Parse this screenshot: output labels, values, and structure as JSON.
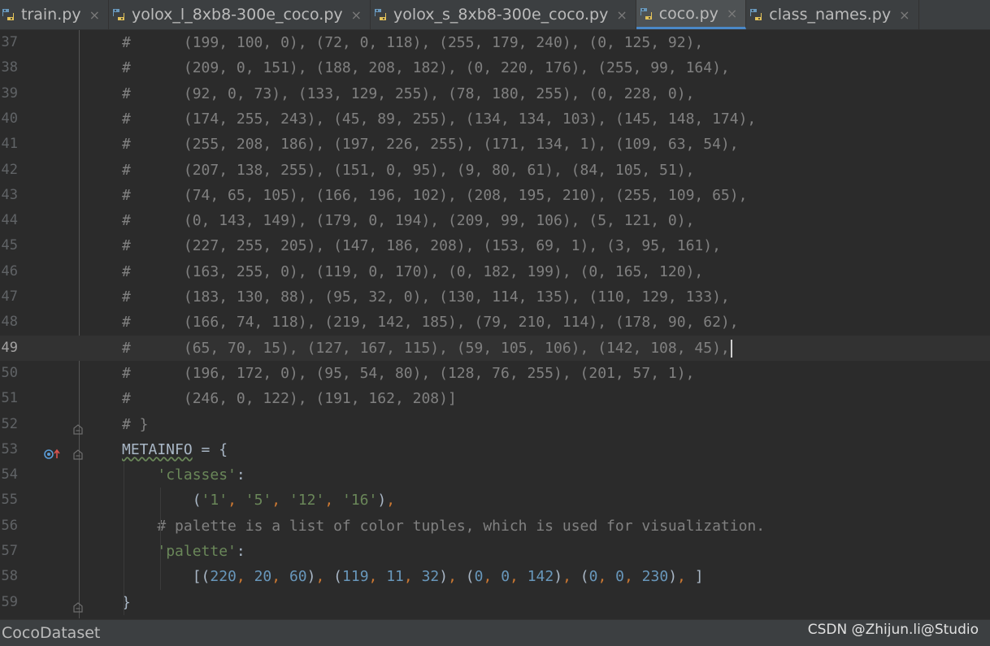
{
  "tabs": [
    {
      "label": "train.py",
      "icon": "python-file-icon",
      "active": false
    },
    {
      "label": "yolox_l_8xb8-300e_coco.py",
      "icon": "python-file-icon",
      "active": false
    },
    {
      "label": "yolox_s_8xb8-300e_coco.py",
      "icon": "python-file-icon",
      "active": false
    },
    {
      "label": "coco.py",
      "icon": "python-file-icon",
      "active": true
    },
    {
      "label": "class_names.py",
      "icon": "python-file-icon",
      "active": false
    }
  ],
  "close_glyph": "×",
  "lines": [
    {
      "n": "37",
      "text": "#      (199, 100, 0), (72, 0, 118), (255, 179, 240), (0, 125, 92),"
    },
    {
      "n": "38",
      "text": "#      (209, 0, 151), (188, 208, 182), (0, 220, 176), (255, 99, 164),"
    },
    {
      "n": "39",
      "text": "#      (92, 0, 73), (133, 129, 255), (78, 180, 255), (0, 228, 0),"
    },
    {
      "n": "40",
      "text": "#      (174, 255, 243), (45, 89, 255), (134, 134, 103), (145, 148, 174),"
    },
    {
      "n": "41",
      "text": "#      (255, 208, 186), (197, 226, 255), (171, 134, 1), (109, 63, 54),"
    },
    {
      "n": "42",
      "text": "#      (207, 138, 255), (151, 0, 95), (9, 80, 61), (84, 105, 51),"
    },
    {
      "n": "43",
      "text": "#      (74, 65, 105), (166, 196, 102), (208, 195, 210), (255, 109, 65),"
    },
    {
      "n": "44",
      "text": "#      (0, 143, 149), (179, 0, 194), (209, 99, 106), (5, 121, 0),"
    },
    {
      "n": "45",
      "text": "#      (227, 255, 205), (147, 186, 208), (153, 69, 1), (3, 95, 161),"
    },
    {
      "n": "46",
      "text": "#      (163, 255, 0), (119, 0, 170), (0, 182, 199), (0, 165, 120),"
    },
    {
      "n": "47",
      "text": "#      (183, 130, 88), (95, 32, 0), (130, 114, 135), (110, 129, 133),"
    },
    {
      "n": "48",
      "text": "#      (166, 74, 118), (219, 142, 185), (79, 210, 114), (178, 90, 62),"
    },
    {
      "n": "49",
      "text": "#      (65, 70, 15), (127, 167, 115), (59, 105, 106), (142, 108, 45),"
    },
    {
      "n": "50",
      "text": "#      (196, 172, 0), (95, 54, 80), (128, 76, 255), (201, 57, 1),"
    },
    {
      "n": "51",
      "text": "#      (246, 0, 122), (191, 162, 208)]"
    },
    {
      "n": "52",
      "text": "# }"
    },
    {
      "n": "53",
      "text": "METAINFO = {"
    },
    {
      "n": "54",
      "text": "    'classes':"
    },
    {
      "n": "55",
      "text": "        ('1', '5', '12', '16'),"
    },
    {
      "n": "56",
      "text": "    # palette is a list of color tuples, which is used for visualization."
    },
    {
      "n": "57",
      "text": "    'palette':"
    },
    {
      "n": "58",
      "text": "        [(220, 20, 60), (119, 11, 32), (0, 0, 142), (0, 0, 230), ]"
    },
    {
      "n": "59",
      "text": "}"
    }
  ],
  "current_line": "49",
  "status": {
    "left": "CocoDataset",
    "watermark": "CSDN @Zhijun.li@Studio"
  },
  "colors": {
    "background": "#2b2b2b",
    "comment": "#808080",
    "keyword": "#cc7832",
    "string": "#6a8759",
    "number": "#6897bb",
    "identifier": "#a9b7c6",
    "accent": "#4a88c7"
  }
}
